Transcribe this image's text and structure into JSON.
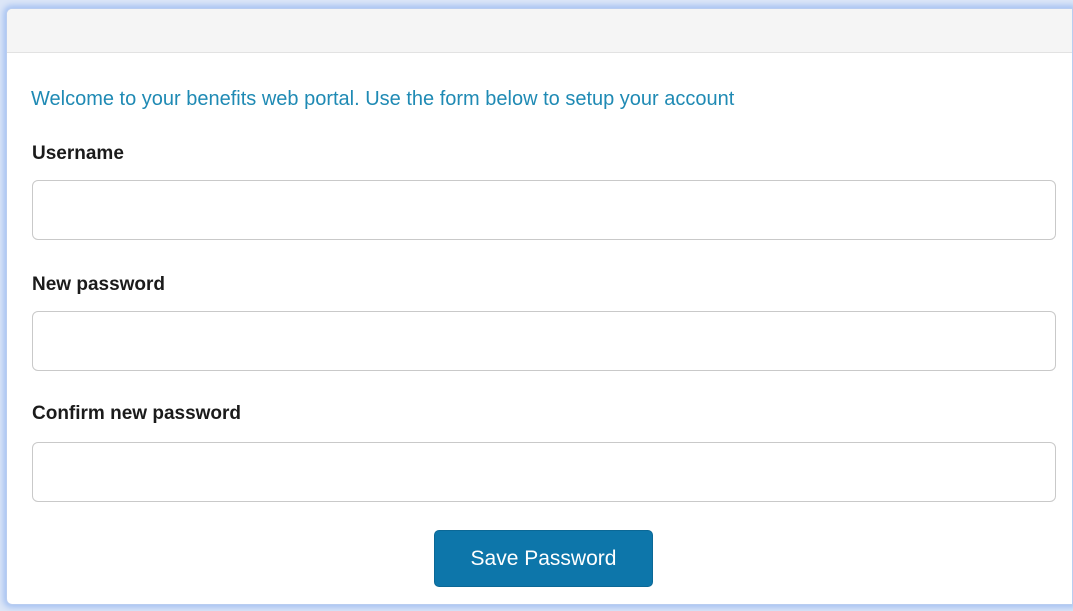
{
  "form": {
    "welcome_text": "Welcome to your benefits web portal. Use the form below to setup your account",
    "username_label": "Username",
    "username_value": "",
    "new_password_label": "New password",
    "new_password_value": "",
    "confirm_password_label": "Confirm new password",
    "confirm_password_value": "",
    "save_button_label": "Save Password"
  },
  "colors": {
    "accent_text": "#1f8ab4",
    "button_bg": "#0d76aa",
    "frame_glow": "#a9c4f2"
  }
}
